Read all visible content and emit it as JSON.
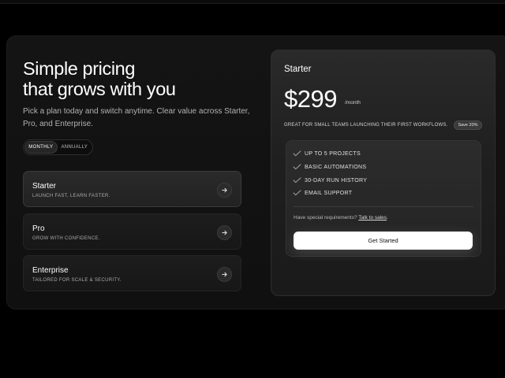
{
  "hero": {
    "headline_line1": "Simple pricing",
    "headline_line2": "that grows with you",
    "subtext": "Pick a plan today and switch anytime. Clear value across Starter, Pro, and Enterprise."
  },
  "billing_toggle": {
    "options": [
      "MONTHLY",
      "ANNUALLY"
    ],
    "selected": "MONTHLY"
  },
  "plans": [
    {
      "name": "Starter",
      "description": "LAUNCH FAST, LEARN FASTER.",
      "active": true
    },
    {
      "name": "Pro",
      "description": "GROW WITH CONFIDENCE.",
      "active": false
    },
    {
      "name": "Enterprise",
      "description": "TAILORED FOR SCALE & SECURITY.",
      "active": false
    }
  ],
  "detail": {
    "title": "Starter",
    "price": "$299",
    "period": "/month",
    "tagline": "GREAT FOR SMALL TEAMS LAUNCHING THEIR FIRST WORKFLOWS.",
    "badge": "Save 20%",
    "features": [
      "UP TO 5 PROJECTS",
      "BASIC AUTOMATIONS",
      "30-DAY RUN HISTORY",
      "EMAIL SUPPORT"
    ],
    "special_prefix": "Have special requirements?",
    "special_link": "Talk to sales",
    "special_suffix": ".",
    "cta_label": "Get Started"
  },
  "icons": {
    "plan_arrow": "arrow-right-icon",
    "feature_check": "check-icon"
  },
  "colors": {
    "background": "#000000",
    "card": "#121212",
    "panel": "#222222",
    "cta": "#ffffff",
    "check": "#9e9e9e"
  }
}
